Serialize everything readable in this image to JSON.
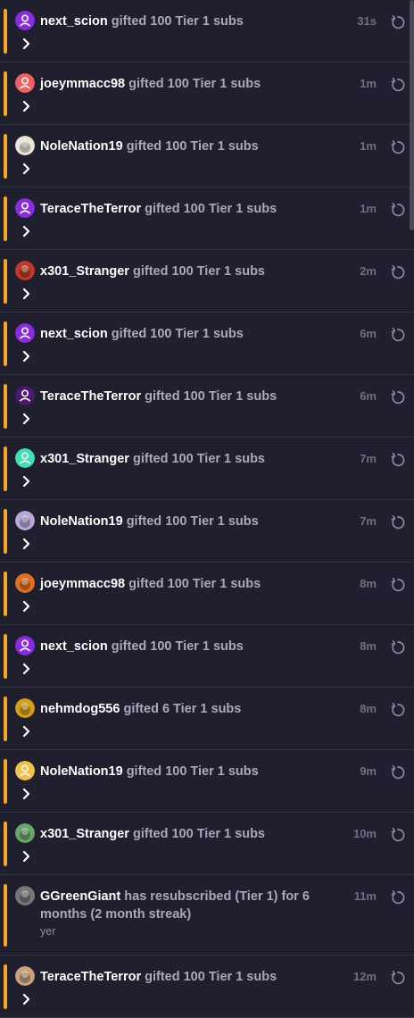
{
  "accent_color": "#f5a623",
  "replay_icon": "replay-icon",
  "expand_icon": "chevron-right-icon",
  "events": [
    {
      "user": "next_scion",
      "action": "gifted 100 Tier 1 subs",
      "time": "31s",
      "avatar": {
        "color": "#8a2be2",
        "icon": "default-user-avatar"
      }
    },
    {
      "user": "joeymmacc98",
      "action": "gifted 100 Tier 1 subs",
      "time": "1m",
      "avatar": {
        "color": "#f06060",
        "icon": "default-user-avatar"
      }
    },
    {
      "user": "NoleNation19",
      "action": "gifted 100 Tier 1 subs",
      "time": "1m",
      "avatar": {
        "color": "#e8e4da",
        "icon": "custom-avatar"
      }
    },
    {
      "user": "TeraceTheTerror",
      "action": "gifted 100 Tier 1 subs",
      "time": "1m",
      "avatar": {
        "color": "#8a2be2",
        "icon": "default-user-avatar"
      }
    },
    {
      "user": "x301_Stranger",
      "action": "gifted 100 Tier 1 subs",
      "time": "2m",
      "avatar": {
        "color": "#c0392b",
        "icon": "custom-avatar"
      }
    },
    {
      "user": "next_scion",
      "action": "gifted 100 Tier 1 subs",
      "time": "6m",
      "avatar": {
        "color": "#8a2be2",
        "icon": "default-user-avatar"
      }
    },
    {
      "user": "TeraceTheTerror",
      "action": "gifted 100 Tier 1 subs",
      "time": "6m",
      "avatar": {
        "color": "#4b1a70",
        "icon": "default-user-avatar"
      }
    },
    {
      "user": "x301_Stranger",
      "action": "gifted 100 Tier 1 subs",
      "time": "7m",
      "avatar": {
        "color": "#40e0b0",
        "icon": "default-user-avatar"
      }
    },
    {
      "user": "NoleNation19",
      "action": "gifted 100 Tier 1 subs",
      "time": "7m",
      "avatar": {
        "color": "#b8a6d9",
        "icon": "custom-avatar"
      }
    },
    {
      "user": "joeymmacc98",
      "action": "gifted 100 Tier 1 subs",
      "time": "8m",
      "avatar": {
        "color": "#e07020",
        "icon": "custom-avatar"
      }
    },
    {
      "user": "next_scion",
      "action": "gifted 100 Tier 1 subs",
      "time": "8m",
      "avatar": {
        "color": "#8a2be2",
        "icon": "default-user-avatar"
      }
    },
    {
      "user": "nehmdog556",
      "action": "gifted 6 Tier 1 subs",
      "time": "8m",
      "avatar": {
        "color": "#d4a017",
        "icon": "custom-avatar"
      }
    },
    {
      "user": "NoleNation19",
      "action": "gifted 100 Tier 1 subs",
      "time": "9m",
      "avatar": {
        "color": "#f5c04a",
        "icon": "default-user-avatar"
      }
    },
    {
      "user": "x301_Stranger",
      "action": "gifted 100 Tier 1 subs",
      "time": "10m",
      "avatar": {
        "color": "#6aa56a",
        "icon": "custom-avatar"
      }
    },
    {
      "user": "GGreenGiant",
      "action": "has resubscribed (Tier 1) for 6 months (2 month streak)",
      "time": "11m",
      "message": "yer",
      "avatar": {
        "color": "#777777",
        "icon": "custom-avatar"
      }
    },
    {
      "user": "TeraceTheTerror",
      "action": "gifted 100 Tier 1 subs",
      "time": "12m",
      "avatar": {
        "color": "#c8a07a",
        "icon": "custom-avatar"
      }
    }
  ]
}
